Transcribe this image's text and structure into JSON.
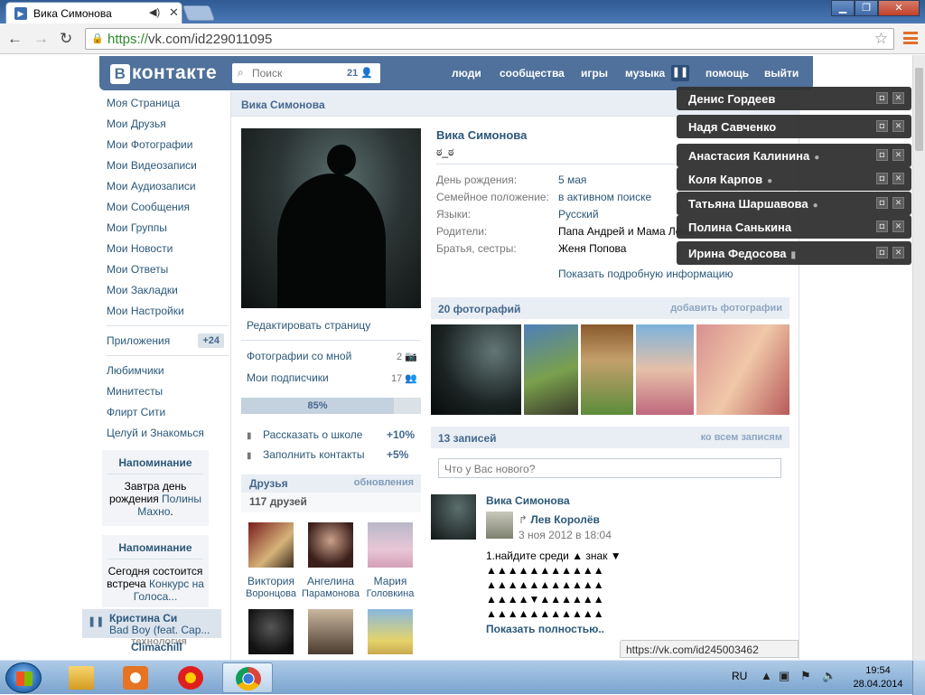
{
  "browser": {
    "tab_title": "Вика Симонова",
    "tab_sound_icon": "speaker-icon",
    "url_https": "https://",
    "url_host": "vk.com/id229011095",
    "status_url": "https://vk.com/id245003462"
  },
  "header": {
    "logo": "контакте",
    "logo_letter": "В",
    "search_placeholder": "Поиск",
    "search_count": "21",
    "links": [
      "люди",
      "сообщества",
      "игры",
      "музыка",
      "помощь",
      "выйти"
    ]
  },
  "leftnav": {
    "items": [
      "Моя Страница",
      "Мои Друзья",
      "Мои Фотографии",
      "Мои Видеозаписи",
      "Мои Аудиозаписи",
      "Мои Сообщения",
      "Мои Группы",
      "Мои Новости",
      "Мои Ответы",
      "Мои Закладки",
      "Мои Настройки"
    ],
    "apps_label": "Приложения",
    "apps_badge": "+24",
    "apps": [
      "Любимчики",
      "Минитесты",
      "Флирт Сити",
      "Целуй и Знакомься"
    ]
  },
  "reminders": [
    {
      "title": "Напоминание",
      "t1": "Завтра ",
      "t2": "день рождения ",
      "t3": "Полины Махно",
      "t4": "."
    },
    {
      "title": "Напоминание",
      "t1": "Сегодня ",
      "t2": "состоится встреча ",
      "t3": "Конкурс на Голоса...",
      "t4": ""
    }
  ],
  "player": {
    "artist": "Кристина Си",
    "song": "Bad Boy (feat. Cap...",
    "below1": "технология",
    "below2": "Climachill"
  },
  "profile": {
    "namebar": "Вика Симонова",
    "name": "Вика Симонова",
    "status": "ಠ_ಠ",
    "fields": [
      {
        "k": "День рождения:",
        "v": "5 мая"
      },
      {
        "k": "Семейное положение:",
        "v": "в активном поиске"
      },
      {
        "k": "Языки:",
        "v": "Русский"
      },
      {
        "k": "Родители:",
        "v": "Папа Андрей и Мама Лена"
      },
      {
        "k": "Братья, сестры:",
        "v": "Женя Попова"
      }
    ],
    "show_more": "Показать подробную информацию",
    "edit": "Редактировать страницу",
    "photos_with_me": "Фотографии со мной",
    "photos_with_me_count": "2",
    "subscribers": "Мои подписчики",
    "subscribers_count": "17",
    "progress_label": "85%",
    "progress_value": 0.85,
    "tip1": "Рассказать о школе",
    "tip1_pct": "+10%",
    "tip2": "Заполнить контакты",
    "tip2_pct": "+5%",
    "friends_title": "Друзья",
    "friends_updates": "обновления",
    "friends_count": "117 друзей",
    "friends": [
      {
        "n1": "Виктория",
        "n2": "Воронцова"
      },
      {
        "n1": "Ангелина",
        "n2": "Парамонова"
      },
      {
        "n1": "Мария",
        "n2": "Головкина"
      }
    ]
  },
  "photos": {
    "title": "20 фотографий",
    "action": "добавить фотографии"
  },
  "wall": {
    "title": "13 записей",
    "action": "ко всем записям",
    "input_placeholder": "Что у Вас нового?",
    "post_author": "Вика Симонова",
    "repost_name": "Лев Королёв",
    "repost_date": "3 ноя 2012 в 18:04",
    "text": "1.найдите среди ▲ знак ▼\n▲▲▲▲▲▲▲▲▲▲▲\n▲▲▲▲▲▲▲▲▲▲▲\n▲▲▲▲▼▲▲▲▲▲▲\n▲▲▲▲▲▲▲▲▲▲▲",
    "show_full": "Показать полностью.."
  },
  "chats": [
    {
      "name": "Денис Гордеев",
      "mark": ""
    },
    {
      "name": "Надя Савченко",
      "mark": ""
    },
    {
      "name": "Анастасия Калинина",
      "mark": "●"
    },
    {
      "name": "Коля Карпов",
      "mark": "●"
    },
    {
      "name": "Татьяна Шаршавова",
      "mark": "●"
    },
    {
      "name": "Полина Санькина",
      "mark": ""
    },
    {
      "name": "Ирина Федосова",
      "mark": "▮"
    }
  ],
  "taskbar": {
    "lang": "RU",
    "time": "19:54",
    "date": "28.04.2014"
  }
}
